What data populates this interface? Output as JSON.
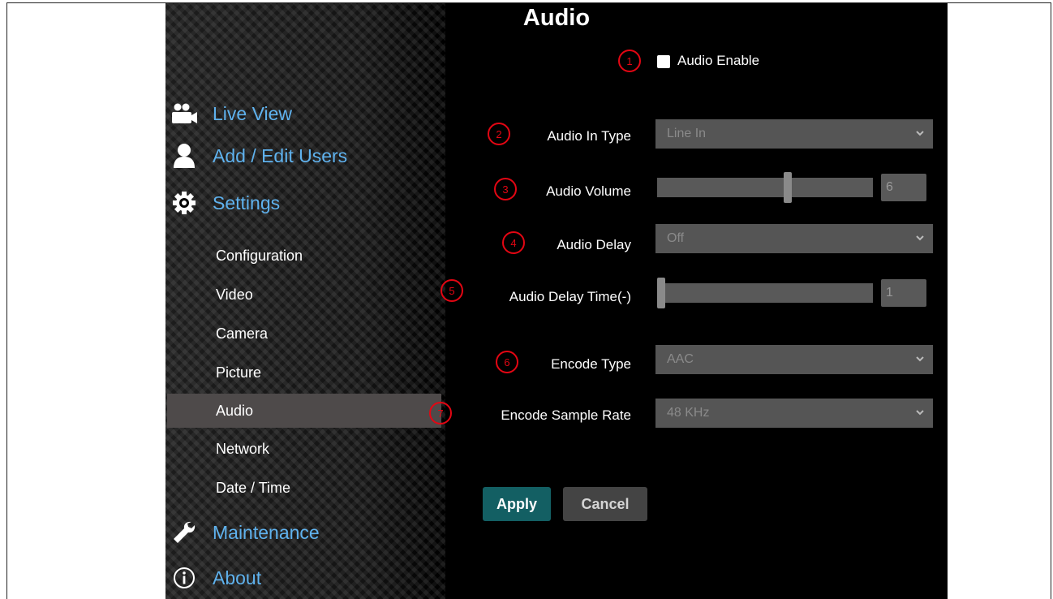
{
  "page_title": "Audio",
  "nav": {
    "live_view": "Live View",
    "add_edit_users": "Add / Edit Users",
    "settings": "Settings",
    "sub": [
      "Configuration",
      "Video",
      "Camera",
      "Picture",
      "Audio",
      "Network",
      "Date / Time"
    ],
    "active_sub": "Audio",
    "maintenance": "Maintenance",
    "about": "About"
  },
  "form": {
    "audio_enable": {
      "badge": "1",
      "label": "Audio Enable",
      "checked": false
    },
    "audio_in_type": {
      "badge": "2",
      "label": "Audio In Type",
      "value": "Line In"
    },
    "audio_volume": {
      "badge": "3",
      "label": "Audio Volume",
      "value": "6",
      "fraction": 0.6
    },
    "audio_delay": {
      "badge": "4",
      "label": "Audio Delay",
      "value": "Off"
    },
    "audio_delay_time": {
      "badge": "5",
      "label": "Audio Delay Time(-)",
      "value": "1",
      "fraction": 0.0
    },
    "encode_type": {
      "badge": "6",
      "label": "Encode Type",
      "value": "AAC"
    },
    "encode_sample_rate": {
      "badge": "7",
      "label": "Encode Sample Rate",
      "value": "48 KHz"
    }
  },
  "buttons": {
    "apply": "Apply",
    "cancel": "Cancel"
  },
  "colors": {
    "accent_blue": "#5fb2ee",
    "annotation_red": "#e30613",
    "apply_teal": "#135f63"
  },
  "icons": [
    "camera-icon",
    "user-icon",
    "gear-icon",
    "wrench-icon",
    "info-icon",
    "chevron-down-icon"
  ]
}
